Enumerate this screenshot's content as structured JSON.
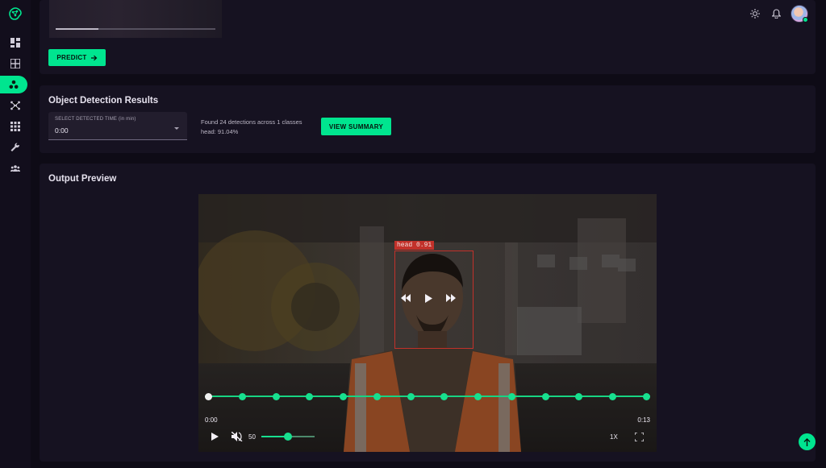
{
  "sidebar": {
    "items": [
      {
        "icon": "dashboard-icon",
        "active": false
      },
      {
        "icon": "grid-icon",
        "active": false
      },
      {
        "icon": "object-detection-icon",
        "active": true
      },
      {
        "icon": "network-icon",
        "active": false
      },
      {
        "icon": "apps-icon",
        "active": false
      },
      {
        "icon": "wrench-icon",
        "active": false
      },
      {
        "icon": "team-icon",
        "active": false
      }
    ]
  },
  "colors": {
    "accent": "#00e58f",
    "bbox": "#c2312a",
    "card": "#161221",
    "background": "#0e0b16"
  },
  "topbar": {
    "icons": [
      "theme-toggle-icon",
      "bell-icon",
      "avatar"
    ]
  },
  "upload": {
    "thumb_progress": 0.27,
    "predict_label": "PREDICT"
  },
  "results": {
    "title": "Object Detection Results",
    "select_label": "SELECT DETECTED TIME (in min)",
    "select_value": "0:00",
    "summary_line1": "Found 24 detections across 1 classes",
    "summary_line2": "head: 91.04%",
    "view_summary_label": "VIEW SUMMARY"
  },
  "preview": {
    "title": "Output Preview",
    "bbox_label": "head 0.91",
    "time_current": "0:00",
    "time_total": "0:13",
    "volume": "50",
    "volume_level": 0.5,
    "speed": "1X",
    "timeline_markers": 14
  }
}
